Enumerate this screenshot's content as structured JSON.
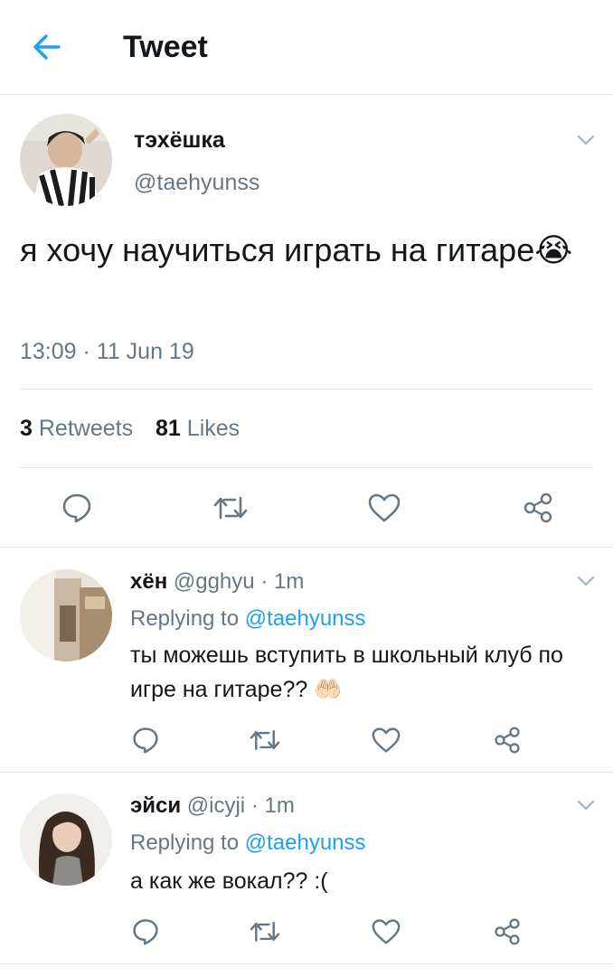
{
  "header": {
    "title": "Tweet",
    "back_icon": "arrow-left-icon",
    "accent": "#1da1f2"
  },
  "tweet": {
    "display_name": "тэхёшка",
    "handle": "@taehyunss",
    "text": "я хочу научиться играть на гитаре",
    "emoji": "😭",
    "timestamp": "13:09 · 11 Jun 19",
    "retweets": {
      "count": "3",
      "label": "Retweets"
    },
    "likes": {
      "count": "81",
      "label": "Likes"
    },
    "actions": [
      "reply-icon",
      "retweet-icon",
      "like-icon",
      "share-icon"
    ]
  },
  "replies": [
    {
      "display_name": "хён",
      "handle": "@gghyu",
      "time": "1m",
      "replying_prefix": "Replying to",
      "replying_to": "@taehyunss",
      "text": "ты можешь вступить в школьный клуб по игре на гитаре??",
      "emoji": "🤲🏻"
    },
    {
      "display_name": "эйси",
      "handle": "@icyji",
      "time": "1m",
      "replying_prefix": "Replying to",
      "replying_to": "@taehyunss",
      "text": "а как же вокал?? :("
    }
  ]
}
